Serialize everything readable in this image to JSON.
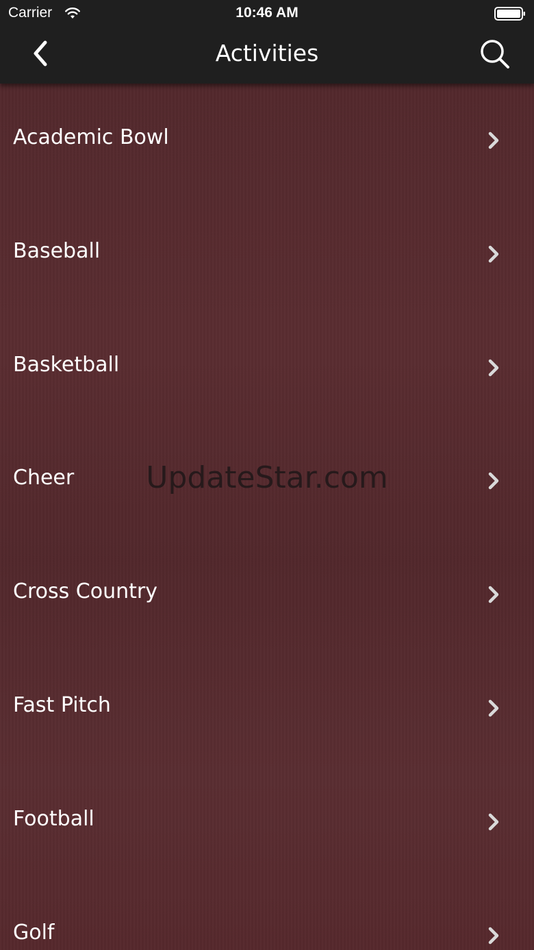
{
  "status_bar": {
    "carrier": "Carrier",
    "time": "10:46 AM"
  },
  "nav": {
    "title": "Activities",
    "back_icon": "chevron-left-icon",
    "search_icon": "search-icon"
  },
  "activities": [
    "Academic Bowl",
    "Baseball",
    "Basketball",
    "Cheer",
    "Cross Country",
    "Fast Pitch",
    "Football",
    "Golf"
  ],
  "watermark": "UpdateStar.com",
  "colors": {
    "nav_background": "#1f1f1f",
    "list_background": "#55292e",
    "text": "#ffffff",
    "chevron": "#d9d9d9"
  }
}
